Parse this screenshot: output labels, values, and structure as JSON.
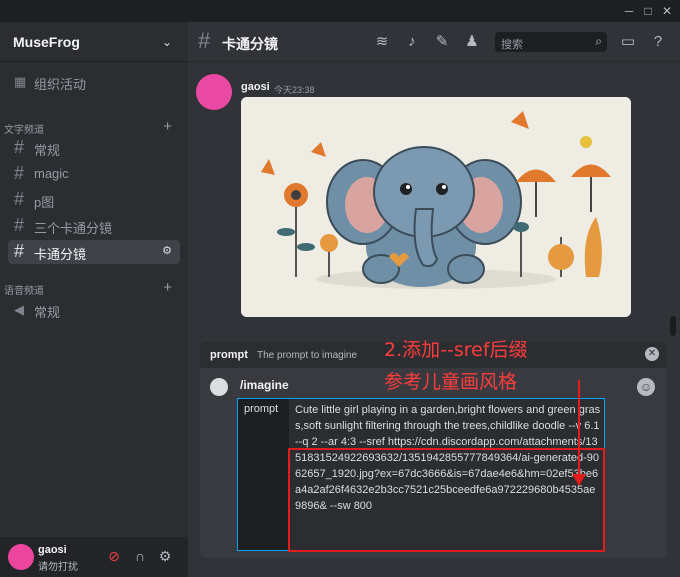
{
  "window": {
    "min_icon": "minimize-icon",
    "max_icon": "maximize-icon",
    "close_icon": "close-icon"
  },
  "server": {
    "name": "MuseFrog"
  },
  "sidebar": {
    "events_label": "组织活动",
    "text_category": "文字频道",
    "text_channels": [
      "常规",
      "magic",
      "p图",
      "三个卡通分镜",
      "卡通分镜"
    ],
    "voice_category": "语音频道",
    "voice_channels": [
      "常规"
    ]
  },
  "user": {
    "name": "gaosi",
    "status": "请勿打扰"
  },
  "channel": {
    "title": "卡通分镜"
  },
  "header": {
    "search_placeholder": "搜索"
  },
  "message": {
    "author": "gaosi",
    "time": "今天23:38"
  },
  "prompt_bar": {
    "title": "prompt",
    "description": "The prompt to imagine"
  },
  "composer": {
    "command": "/imagine",
    "option_label": "prompt",
    "option_text": "Cute little girl playing in a garden,bright flowers and green grass,soft sunlight filtering through the trees,childlike doodle --v 6.1 --q 2 --ar 4:3 --sref https://cdn.discordapp.com/attachments/1351831524922693632/1351942855777849364/ai-generated-9062657_1920.jpg?ex=67dc3666&is=67dae4e6&hm=02ef53be6a4a2af26f4632e2b3cc7521c25bceedfe6a972229680b4535ae9896& --sw 800"
  },
  "annotation": {
    "line1": "2.添加--sref后缀",
    "line2": "参考儿童画风格"
  },
  "colors": {
    "accent_red": "#e31d1d",
    "focus_blue": "#00a8fc",
    "avatar_pink": "#eb459e"
  }
}
